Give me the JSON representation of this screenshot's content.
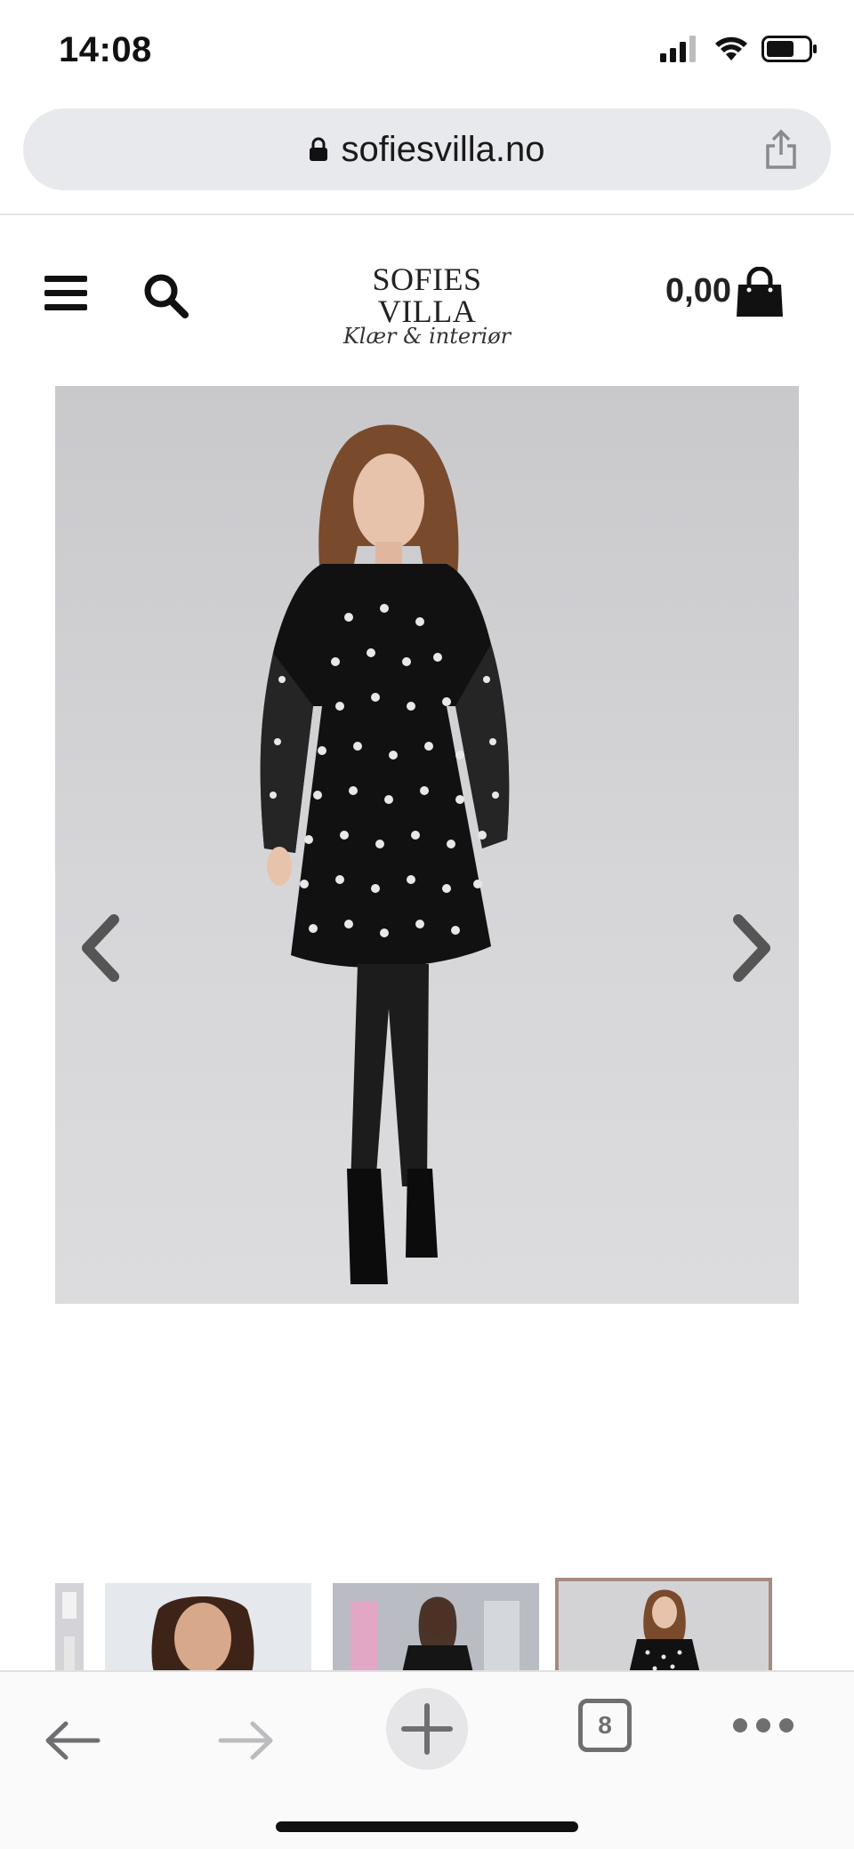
{
  "status": {
    "time": "14:08"
  },
  "browser": {
    "url": "sofiesvilla.no",
    "tab_count": "8"
  },
  "header": {
    "logo_main": "SOFIES VILLA",
    "logo_sub": "Klær & interiør",
    "cart_amount": "0,00"
  },
  "icons": {
    "menu": "hamburger-menu-icon",
    "search": "search-icon",
    "cart": "shopping-bag-icon",
    "prev": "chevron-left-icon",
    "next": "chevron-right-icon"
  },
  "colors": {
    "url_bar_bg": "#e8e9ec",
    "thumb_selected_border": "#a58b82",
    "arrow": "#555555"
  }
}
